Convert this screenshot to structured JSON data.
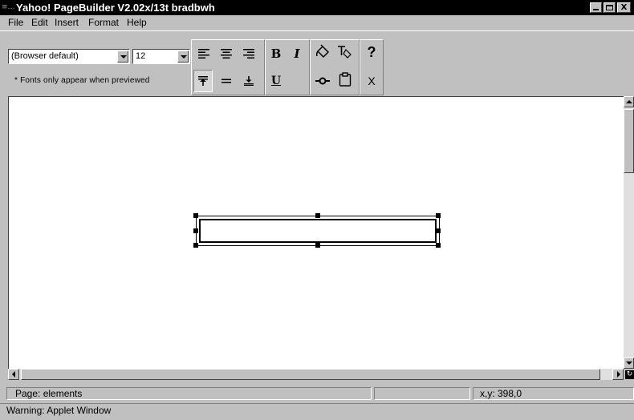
{
  "window": {
    "title": "Yahoo! PageBuilder V2.02x/13t bradbwh",
    "icon": "applet-window-icon",
    "controls": {
      "minimize": "minimize-icon",
      "maximize": "maximize-icon",
      "close_label": "X"
    }
  },
  "menubar": {
    "items": [
      {
        "label": "File"
      },
      {
        "label": "Edit"
      },
      {
        "label": "Insert"
      },
      {
        "label": "Format"
      },
      {
        "label": "Help"
      }
    ]
  },
  "toolbar": {
    "font_select": {
      "value": "(Browser default)"
    },
    "size_select": {
      "value": "12"
    },
    "hint": "* Fonts only appear when previewed",
    "align_buttons": [
      {
        "icon": "align-left-icon"
      },
      {
        "icon": "align-center-icon"
      },
      {
        "icon": "align-right-icon"
      }
    ],
    "valign_buttons": [
      {
        "icon": "align-top-icon"
      },
      {
        "icon": "align-middle-icon"
      },
      {
        "icon": "align-bottom-icon"
      }
    ],
    "style_buttons": {
      "bold": "B",
      "italic": "I",
      "underline": "U"
    },
    "tool_buttons": [
      {
        "icon": "paint-bucket-icon"
      },
      {
        "icon": "text-color-icon"
      },
      {
        "icon": "link-icon"
      },
      {
        "icon": "clipboard-icon"
      }
    ],
    "help_label": "?",
    "close_label": "X"
  },
  "canvas": {
    "background": "#ffffff",
    "selected_element": "text-element"
  },
  "status": {
    "page": "Page: elements",
    "middle": "",
    "coords": "x,y: 398,0",
    "warning": "Warning: Applet Window"
  },
  "colors": {
    "titlebar": "#000000",
    "chrome": "#c0c0c0",
    "canvas": "#ffffff"
  }
}
